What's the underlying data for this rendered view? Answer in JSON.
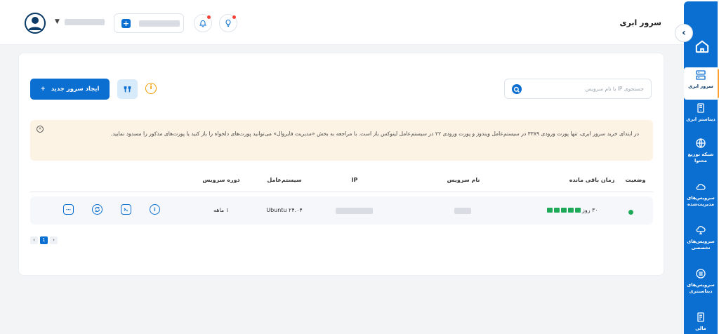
{
  "header": {
    "page_title": "سرور ابری"
  },
  "sidebar": {
    "items": [
      {
        "label": "سرور ابری",
        "icon": "server-icon",
        "active": true
      },
      {
        "label": "دیتاستر ابری",
        "icon": "datastore-icon",
        "active": false
      },
      {
        "label": "شبکه توزیع محتوا",
        "icon": "cdn-globe-icon",
        "active": false
      },
      {
        "label": "سرویس‌های مدیریت‌شده",
        "icon": "managed-cloud-icon",
        "active": false
      },
      {
        "label": "سرویس‌های تخصصی",
        "icon": "specialized-icon",
        "active": false
      },
      {
        "label": "سرویس‌های دیتاسنتری",
        "icon": "datacenter-icon",
        "active": false
      },
      {
        "label": "مالی",
        "icon": "finance-icon",
        "active": false
      }
    ]
  },
  "toolbar": {
    "search_placeholder": "جستجوی IP یا نام سرویس",
    "new_server_label": "ایجاد سرور جدید",
    "new_server_plus": "+"
  },
  "alert": {
    "text": "در ابتدای خرید سرور ابری، تنها پورت ورودی ۳۳۸۹ در سیستم‌عامل ویندوز و پورت ورودی ۲۲ در سیستم‌عامل لینوکس باز است. با مراجعه به بخش «مدیریت فایروال» می‌توانید پورت‌های دلخواه را باز کنید یا پورت‌های مذکور را مسدود نمایید."
  },
  "table": {
    "headers": {
      "status": "وضعیت",
      "time_left": "زمان باقی مانده",
      "service_name": "نام سرویس",
      "ip": "IP",
      "os": "سیستم‌عامل",
      "period": "دوره سرویس"
    },
    "rows": [
      {
        "status": "active",
        "time_left": "۳۰ روز",
        "time_bar_fraction": 1.0,
        "os": "Ubuntu ۲۴.۰۴",
        "period": "۱ ماهه"
      }
    ]
  },
  "pagination": {
    "prev": "‹",
    "current": "1",
    "next": "›"
  },
  "colors": {
    "primary": "#0b6fd1",
    "accent_orange": "#ff9f2e",
    "status_green": "#1faa59",
    "alert_bg": "#fdf3e4"
  }
}
